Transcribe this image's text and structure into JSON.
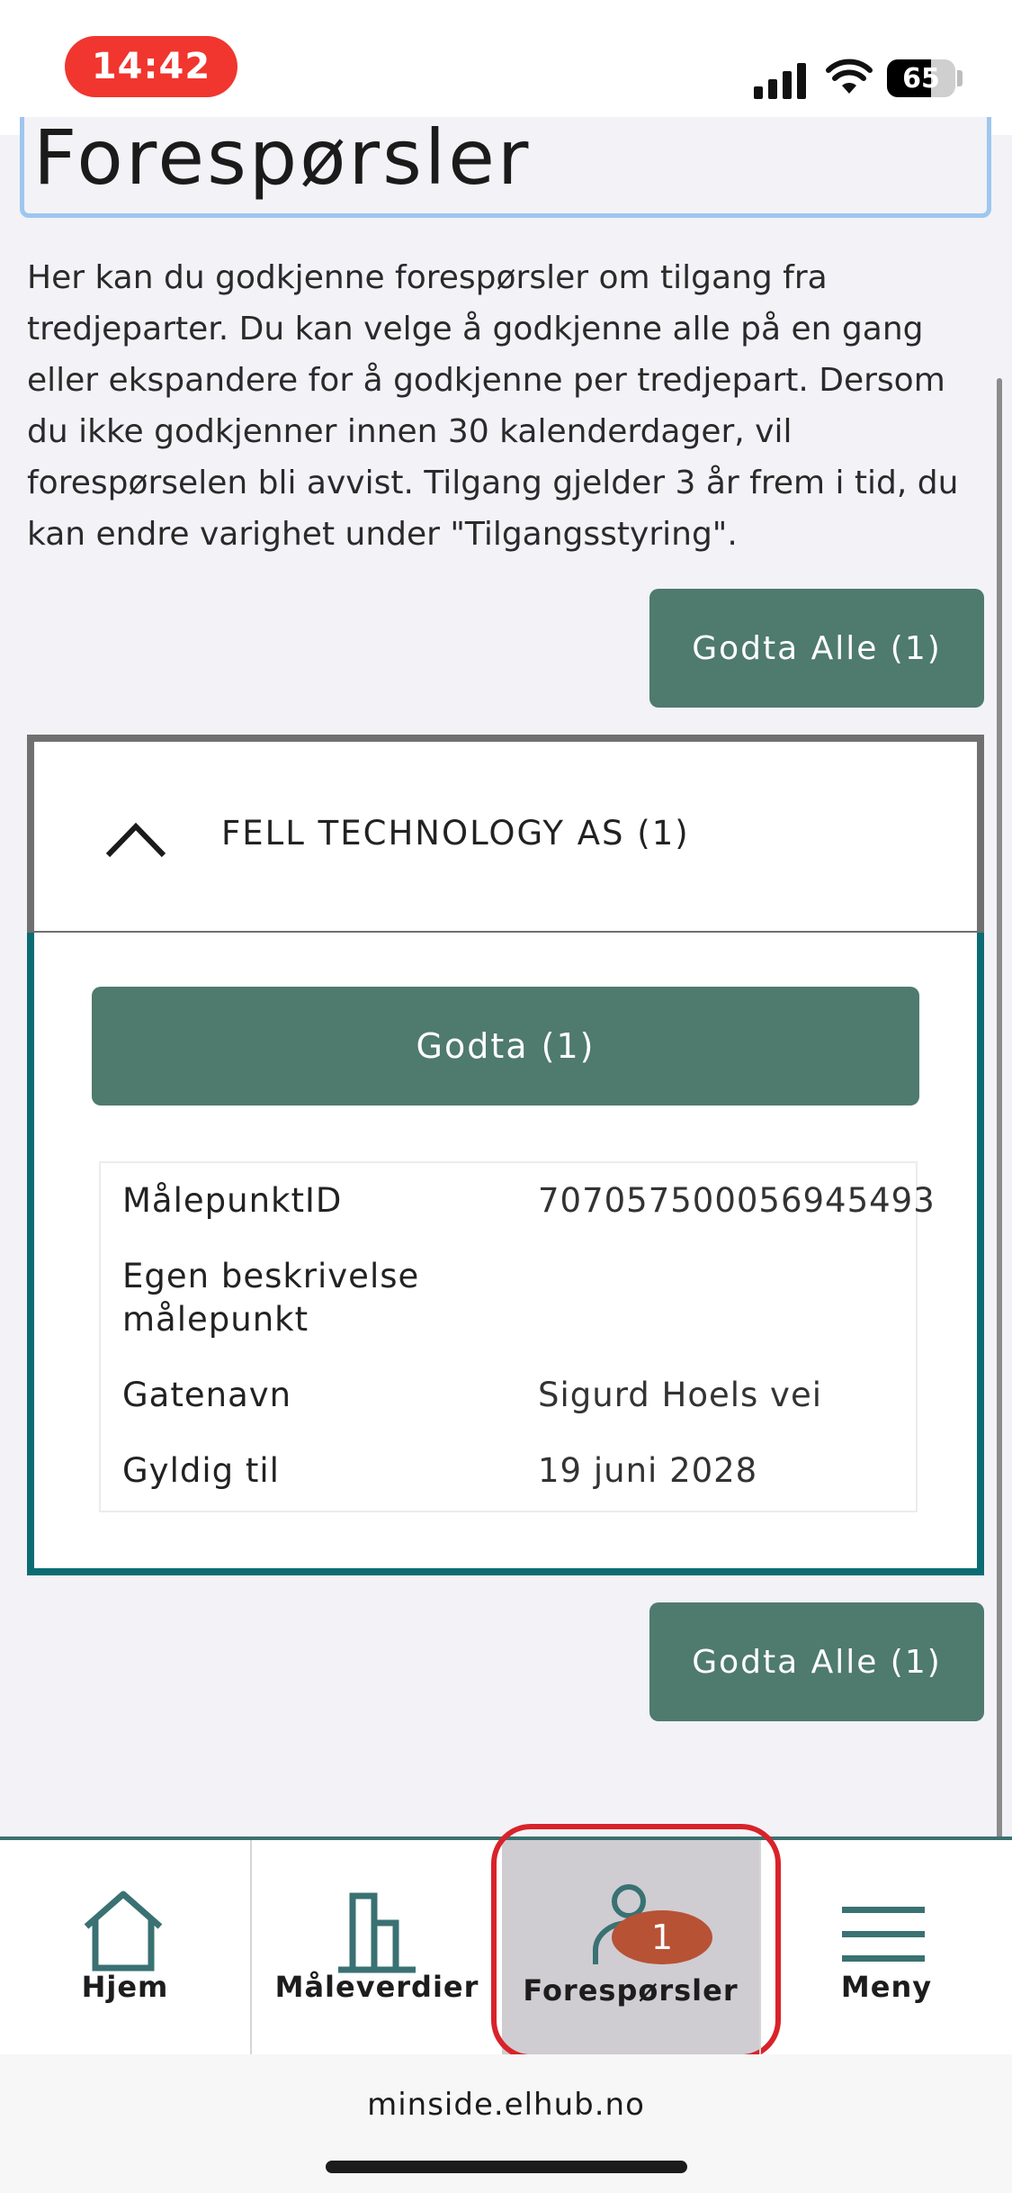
{
  "status_bar": {
    "time": "14:42",
    "battery_level": "65",
    "icons": [
      "cellular-signal-icon",
      "wifi-icon",
      "battery-icon"
    ]
  },
  "page": {
    "title": "Forespørsler",
    "intro": "Her kan du godkjenne forespørsler om tilgang fra tredjeparter. Du kan velge å godkjenne alle på en gang eller ekspandere for å godkjenne per tredjepart. Dersom du ikke godkjenner innen 30 kalenderdager, vil forespørselen bli avvist. Tilgang gjelder 3 år frem i tid, du kan endre varighet under \"Tilgangsstyring\".",
    "approve_all_label": "Godta Alle (1)"
  },
  "request_card": {
    "company": "FELL TECHNOLOGY AS (1)",
    "expanded": true,
    "approve_label": "Godta (1)",
    "details": [
      {
        "label": "MålepunktID",
        "value": "707057500056945493"
      },
      {
        "label": "Egen beskrivelse målepunkt",
        "value": ""
      },
      {
        "label": "Gatenavn",
        "value": "Sigurd Hoels vei"
      },
      {
        "label": "Gyldig til",
        "value": "19 juni 2028"
      }
    ]
  },
  "tab_bar": {
    "tabs": [
      {
        "label": "Hjem",
        "icon": "home-icon"
      },
      {
        "label": "Måleverdier",
        "icon": "bar-chart-icon"
      },
      {
        "label": "Forespørsler",
        "icon": "person-icon",
        "badge": "1",
        "active": true
      },
      {
        "label": "Meny",
        "icon": "hamburger-menu-icon"
      }
    ]
  },
  "browser": {
    "url": "minside.elhub.no"
  },
  "colors": {
    "primary_button": "#4f7a6e",
    "card_border_expanded": "#0c6c74",
    "badge": "#b75235",
    "highlight": "#d8232a",
    "time_pill": "#f0362e"
  }
}
